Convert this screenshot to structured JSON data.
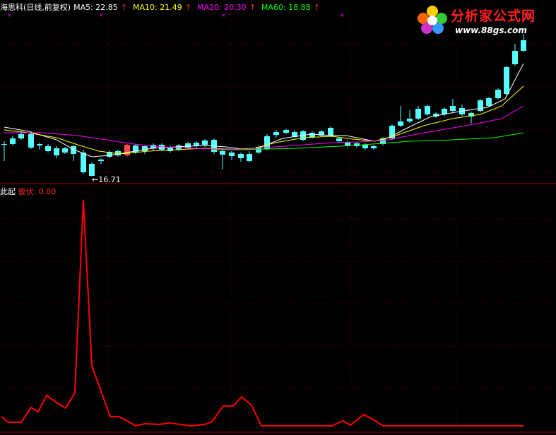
{
  "header": {
    "title": "海思科(日线,前复权)",
    "ma5": "MA5: 22.85",
    "ma10": "MA10: 21.49",
    "ma20": "MA20: 20.30",
    "ma60": "MA60: 18.88",
    "arrow": "↑"
  },
  "colors": {
    "bull": "#ff4b4b",
    "bear": "#54ffff",
    "ma5": "#ffffff",
    "ma10": "#ffff00",
    "ma20": "#ff00ff",
    "ma60": "#00ff00",
    "indicator": "#ff0000",
    "grid": "#7a0000"
  },
  "price_panel": {
    "low_marker": "←16.71"
  },
  "indicator_panel": {
    "name": "此起",
    "series_label": "彼伏: 0.00"
  },
  "logo": {
    "text": "分析家公式网",
    "url": "www.88gs.com"
  }
}
